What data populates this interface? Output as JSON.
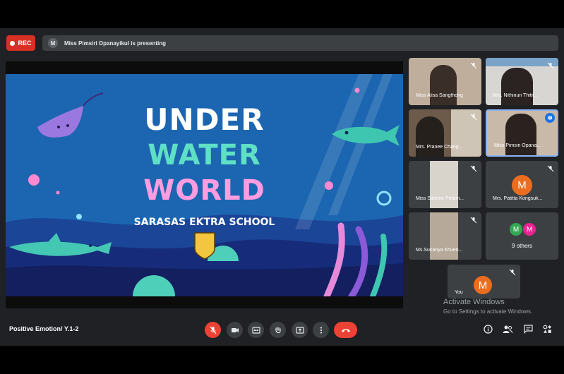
{
  "topbar": {
    "rec_label": "REC",
    "presenter_initial": "M",
    "presenting_text": "Miss Pimsiri Opanayikul is presenting"
  },
  "slide": {
    "line1": "UNDER",
    "line2": "WATER",
    "line3": "WORLD",
    "school": "SARASAS EKTRA SCHOOL"
  },
  "participants": [
    {
      "name": "Miss Alisa Sangthong"
    },
    {
      "name": "Mrs. Nithinun Thitit..."
    },
    {
      "name": "Mrs. Pranee Chang..."
    },
    {
      "name": "Miss Pimsiri Opana..."
    },
    {
      "name": "Miss Satinee Petam..."
    },
    {
      "name": "Mrs. Patitta Kongsuk...",
      "initial": "M"
    },
    {
      "name": "Ms.Sukanya Khuen..."
    },
    {
      "name": "9 others",
      "initials": [
        "M",
        "M"
      ]
    },
    {
      "name": "You",
      "initial": "M"
    }
  ],
  "watermark": {
    "line1": "Activate Windows",
    "line2": "Go to Settings to activate Windows."
  },
  "bottom": {
    "meeting_name": "Positive Emotion/ Y.1-2"
  },
  "colors": {
    "accent_red": "#ea4335",
    "rec_red": "#d93025",
    "avatar_orange": "#ec6d1f",
    "avatar_green": "#33a852",
    "avatar_pink": "#e52592",
    "active_blue": "#8ab4f8"
  }
}
